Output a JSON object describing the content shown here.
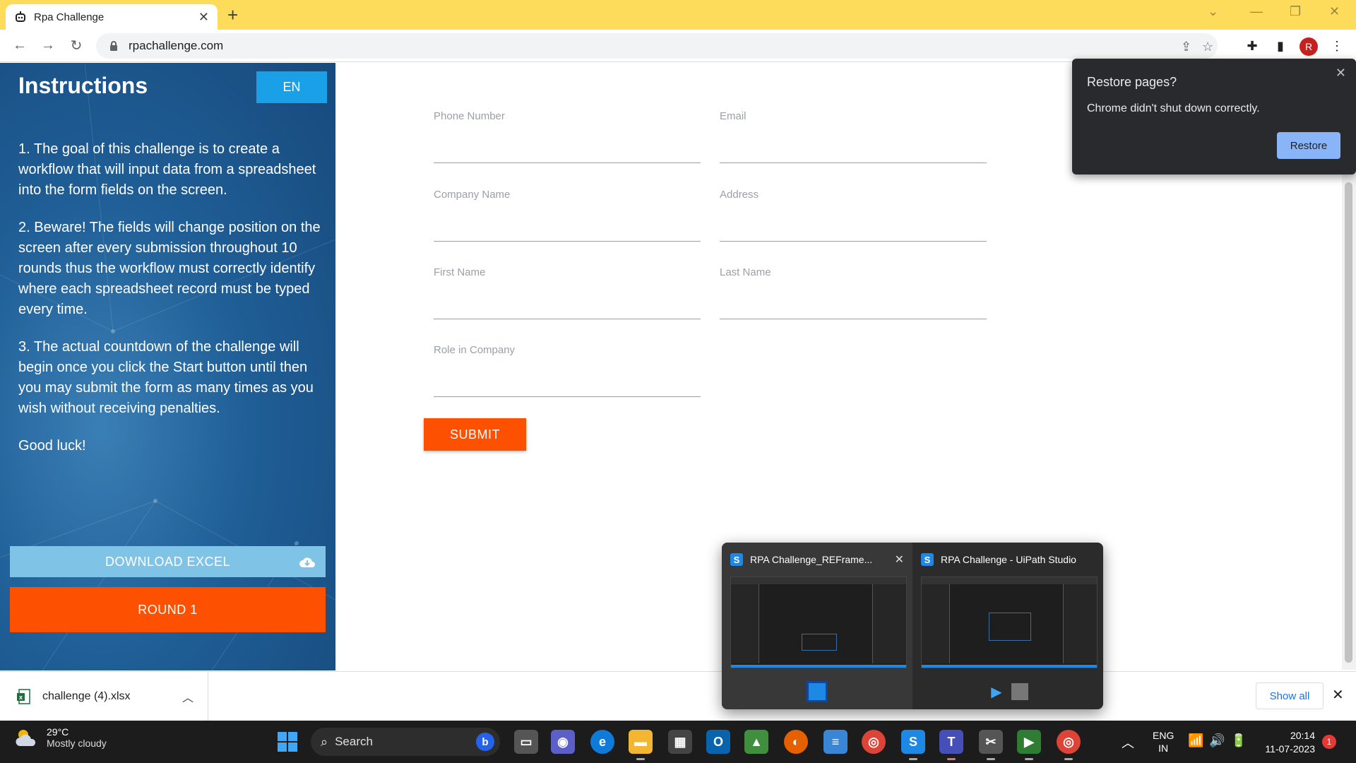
{
  "browser": {
    "tab_title": "Rpa Challenge",
    "url": "rpachallenge.com",
    "profile_initial": "R",
    "accent": "#fcdc5a"
  },
  "sidebar": {
    "title": "Instructions",
    "lang_button": "EN",
    "instructions": [
      "1. The goal of this challenge is to create a workflow that will input data from a spreadsheet into the form fields on the screen.",
      "2. Beware! The fields will change position on the screen after every submission throughout 10 rounds thus the workflow must correctly identify where each spreadsheet record must be typed every time.",
      "3. The actual countdown of the challenge will begin once you click the Start button until then you may submit the form as many times as you wish without receiving penalties.",
      "Good luck!"
    ],
    "download_button": "DOWNLOAD EXCEL",
    "round_button": "ROUND 1"
  },
  "form": {
    "fields": [
      {
        "label": "Phone Number",
        "value": ""
      },
      {
        "label": "Email",
        "value": ""
      },
      {
        "label": "Company Name",
        "value": ""
      },
      {
        "label": "Address",
        "value": ""
      },
      {
        "label": "First Name",
        "value": ""
      },
      {
        "label": "Last Name",
        "value": ""
      },
      {
        "label": "Role in Company",
        "value": ""
      }
    ],
    "submit_label": "SUBMIT"
  },
  "restore_popup": {
    "title": "Restore pages?",
    "message": "Chrome didn't shut down correctly.",
    "button": "Restore"
  },
  "download_bar": {
    "file_name": "challenge (4).xlsx",
    "show_all": "Show all"
  },
  "taskbar_preview": {
    "windows": [
      {
        "title": "RPA Challenge_REFrame..."
      },
      {
        "title": "RPA Challenge - UiPath Studio"
      }
    ]
  },
  "taskbar": {
    "weather_temp": "29°C",
    "weather_desc": "Mostly cloudy",
    "search_placeholder": "Search",
    "lang_line1": "ENG",
    "lang_line2": "IN",
    "time": "20:14",
    "date": "11-07-2023",
    "notification_count": "1"
  }
}
